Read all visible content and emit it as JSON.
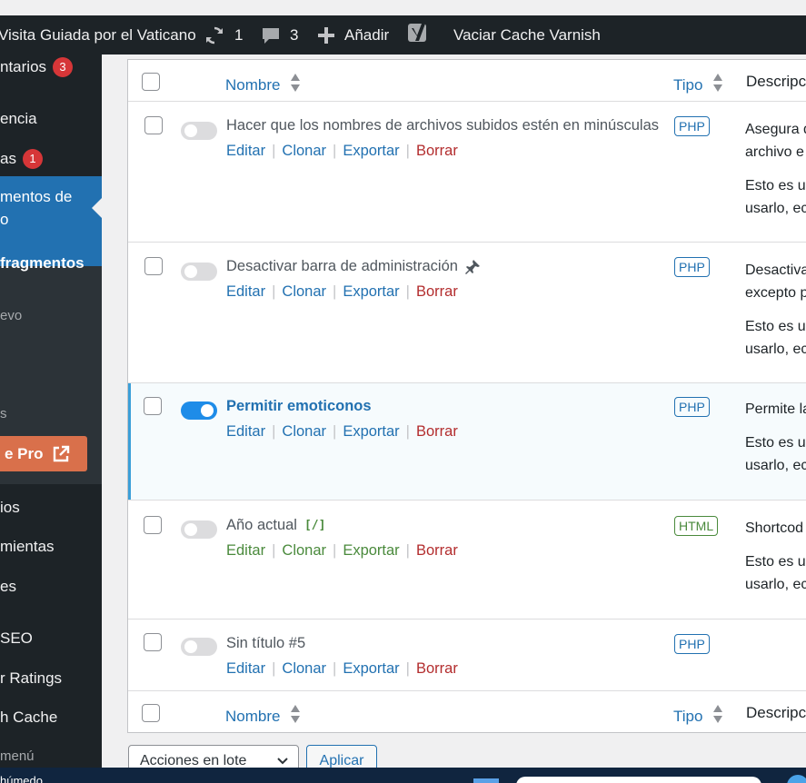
{
  "adminbar": {
    "site_name": "Visita Guiada por el Vaticano",
    "updates_count": "1",
    "comments_count": "3",
    "new_label": "Añadir",
    "varnish_label": "Vaciar Cache Varnish"
  },
  "sidebar": {
    "comments_label": "ntarios",
    "comments_badge": "3",
    "appearance_label": "encia",
    "plugins_label": "as",
    "plugins_badge": "1",
    "current_label_1": "mentos de",
    "current_label_2": "o",
    "sub_all": "fragmentos",
    "sub_new": "evo",
    "sub_s": "s",
    "pro_label": "e Pro",
    "users_label": "ios",
    "tools_label": "mientas",
    "settings_label": "es",
    "seo_label": "SEO",
    "ratings_label": "r Ratings",
    "cache_label": "h Cache",
    "collapse_label": "menú"
  },
  "taskbar": {
    "weather_text": "húmedo"
  },
  "table": {
    "header": {
      "name": "Nombre",
      "type": "Tipo",
      "description": "Descripción"
    },
    "footer": {
      "name": "Nombre",
      "type": "Tipo",
      "description": "Descripción"
    },
    "actions": {
      "edit": "Editar",
      "clone": "Clonar",
      "export": "Exportar",
      "delete": "Borrar"
    },
    "rows": [
      {
        "title": "Hacer que los nombres de archivos subidos estén en minúsculas",
        "type": "PHP",
        "active": false,
        "desc1": "Asegura q",
        "desc2": "archivo e",
        "desc3": "Esto es un",
        "desc4": "usarlo, ec"
      },
      {
        "title": "Desactivar barra de administración",
        "type": "PHP",
        "active": false,
        "pin_icon": "pin-icon",
        "desc1": "Desactiva",
        "desc2": "excepto p",
        "desc3": "Esto es un",
        "desc4": "usarlo, ec"
      },
      {
        "title": "Permitir emoticonos",
        "type": "PHP",
        "active": true,
        "desc1": "Permite la",
        "desc3": "Esto es un",
        "desc4": "usarlo, ec"
      },
      {
        "title": "Año actual",
        "type": "HTML",
        "active": false,
        "shortcode_glyph": "[/]",
        "desc1": "Shortcod",
        "desc3": "Esto es un",
        "desc4": "usarlo, ec"
      },
      {
        "title": "Sin título #5",
        "type": "PHP",
        "active": false
      }
    ]
  },
  "bulk": {
    "select_value": "Acciones en lote",
    "apply_label": "Aplicar"
  },
  "colors": {
    "accent": "#2271b1",
    "sidebar_bg": "#1d2327",
    "toggle_on": "#1e8ce8",
    "delete": "#b32d2e",
    "html": "#4a8a3c"
  }
}
